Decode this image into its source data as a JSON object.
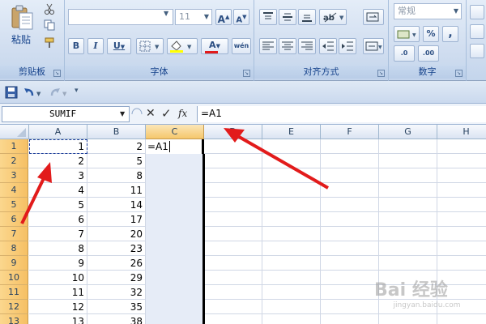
{
  "ribbon": {
    "clipboard": {
      "paste_label": "粘贴",
      "group_label": "剪贴板"
    },
    "font": {
      "font_name": "",
      "font_size": "11",
      "grow_label": "A",
      "shrink_label": "A",
      "bold": "B",
      "italic": "I",
      "underline": "U",
      "font_color_label": "A",
      "phonetic_label": "wén",
      "group_label": "字体"
    },
    "alignment": {
      "group_label": "对齐方式"
    },
    "number": {
      "format": "常规",
      "percent": "%",
      "comma": ",",
      "inc_decimal": ".0",
      "dec_decimal": ".00",
      "group_label": "数字"
    }
  },
  "formula_bar": {
    "name_box": "SUMIF",
    "fx_label": "fx",
    "formula": "=A1"
  },
  "columns": [
    "A",
    "B",
    "C",
    "D",
    "E",
    "F",
    "G",
    "H"
  ],
  "rows": [
    {
      "num": "1",
      "a": "1",
      "b": "2"
    },
    {
      "num": "2",
      "a": "2",
      "b": "5"
    },
    {
      "num": "3",
      "a": "3",
      "b": "8"
    },
    {
      "num": "4",
      "a": "4",
      "b": "11"
    },
    {
      "num": "5",
      "a": "5",
      "b": "14"
    },
    {
      "num": "6",
      "a": "6",
      "b": "17"
    },
    {
      "num": "7",
      "a": "7",
      "b": "20"
    },
    {
      "num": "8",
      "a": "8",
      "b": "23"
    },
    {
      "num": "9",
      "a": "9",
      "b": "26"
    },
    {
      "num": "10",
      "a": "10",
      "b": "29"
    },
    {
      "num": "11",
      "a": "11",
      "b": "32"
    },
    {
      "num": "12",
      "a": "12",
      "b": "35"
    },
    {
      "num": "13",
      "a": "13",
      "b": "38"
    }
  ],
  "editing_cell": {
    "value": "=A1"
  },
  "watermark": {
    "brand": "Bai 经验",
    "url": "jingyan.baidu.com"
  },
  "colors": {
    "accent": "#e21b1b",
    "row_header": "#f6c064",
    "selected_col": "#e6ecf7"
  }
}
